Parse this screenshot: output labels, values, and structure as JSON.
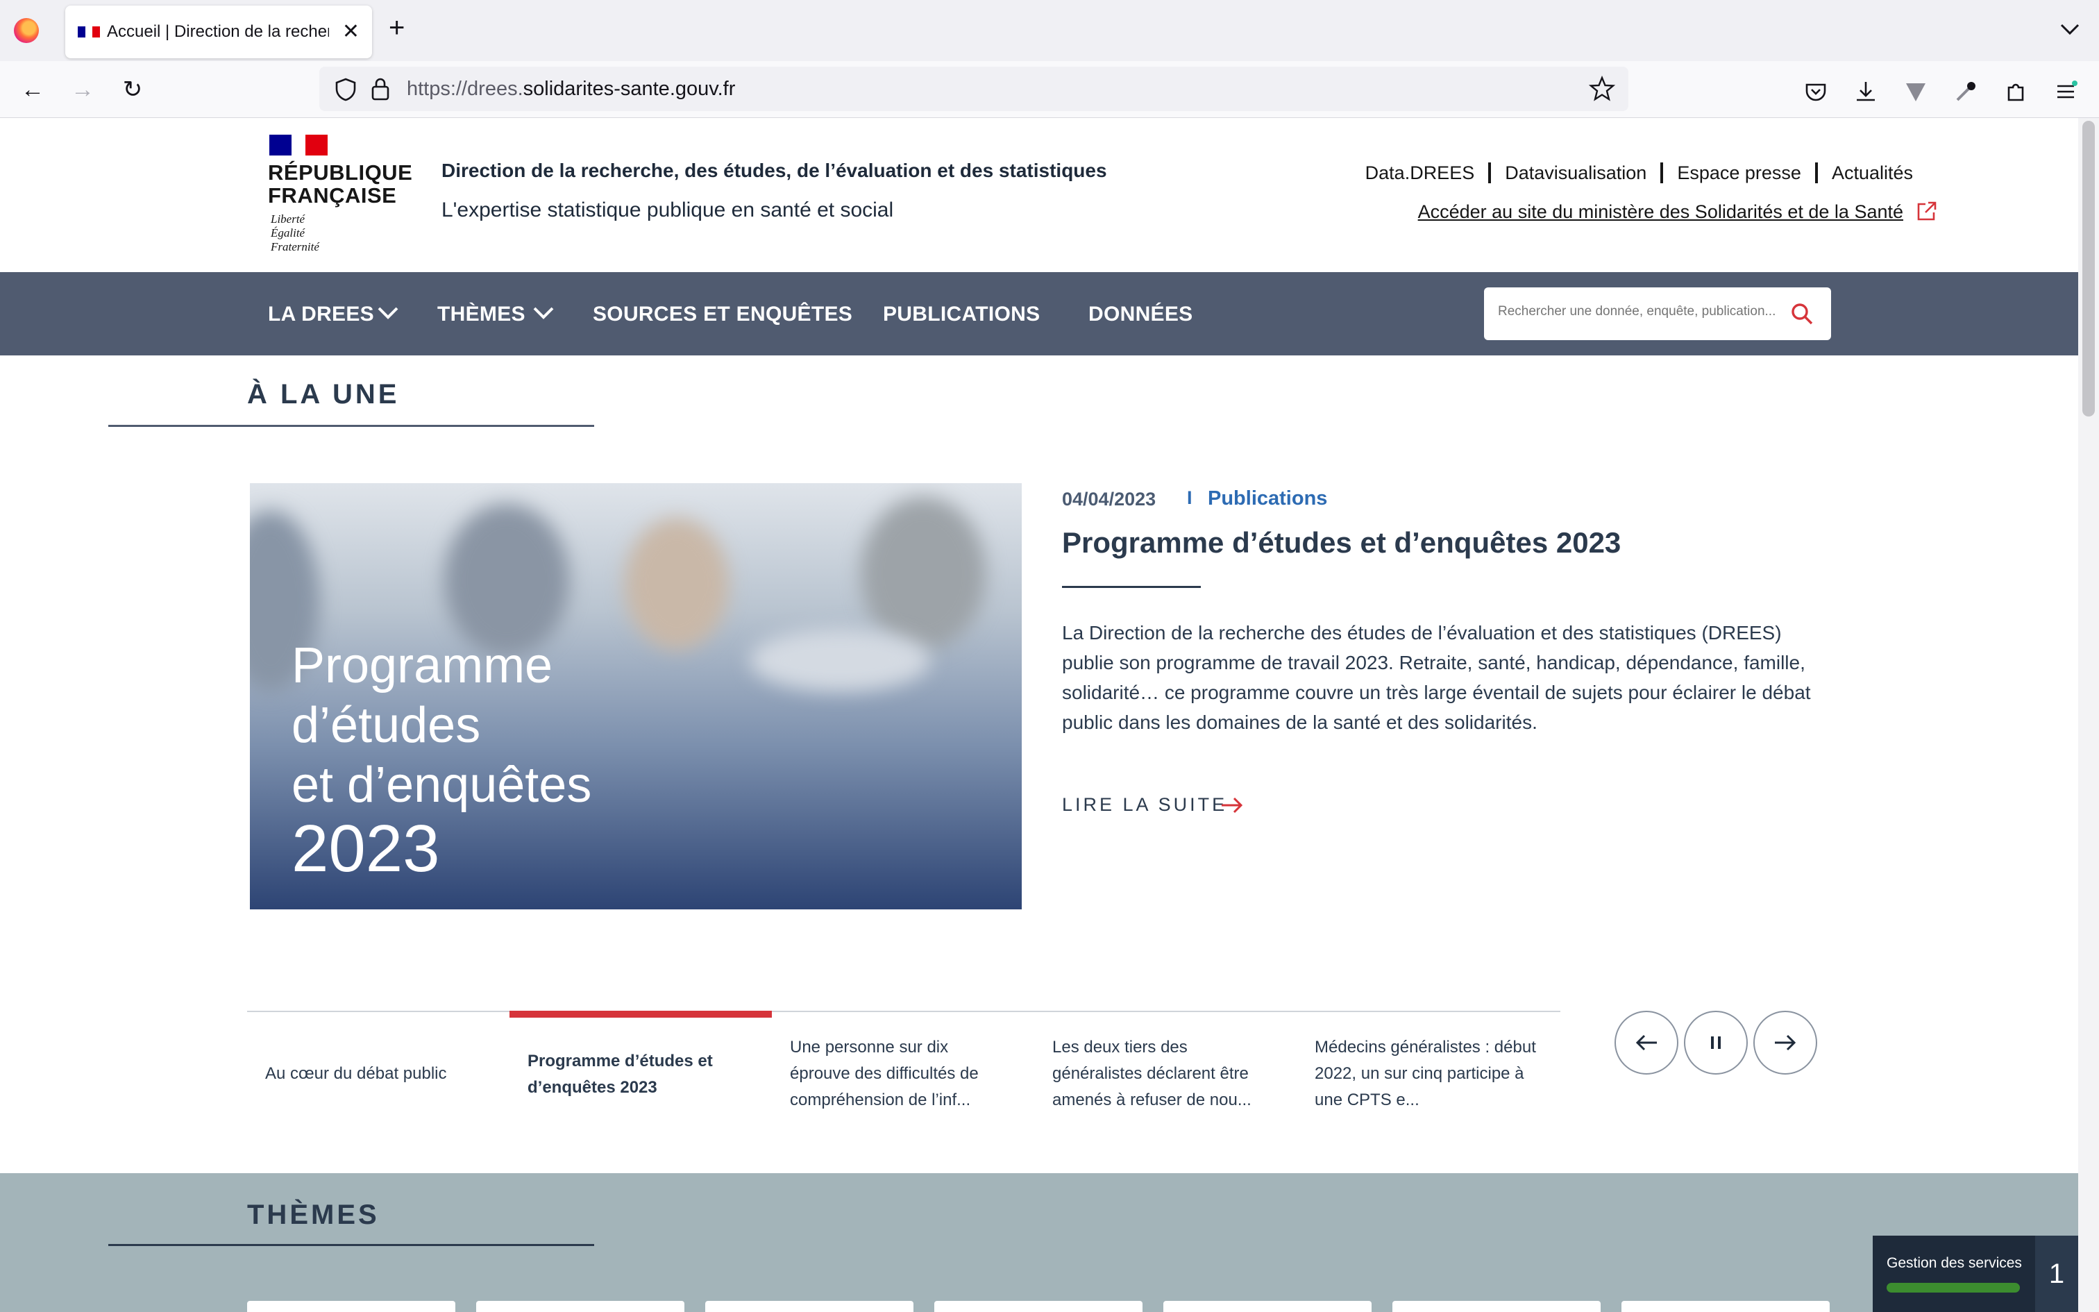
{
  "browser": {
    "tab_title": "Accueil | Direction de la recherche",
    "url_prefix": "https://drees.",
    "url_host": "solidarites-sante.gouv.fr"
  },
  "header": {
    "republique_line1": "RÉPUBLIQUE",
    "republique_line2": "FRANÇAISE",
    "motto_1": "Liberté",
    "motto_2": "Égalité",
    "motto_3": "Fraternité",
    "org_title": "Direction de la recherche, des études, de l’évaluation et des statistiques",
    "tagline": "L'expertise statistique publique en santé et social",
    "top_links": [
      "Data.DREES",
      "Datavisualisation",
      "Espace presse",
      "Actualités"
    ],
    "ministry_link": "Accéder au site du ministère des Solidarités et de la Santé"
  },
  "nav": {
    "items": [
      "LA DREES",
      "THÈMES",
      "SOURCES ET ENQUÊTES",
      "PUBLICATIONS",
      "DONNÉES"
    ],
    "search_placeholder": "Rechercher une donnée, enquête, publication..."
  },
  "a_la_une": {
    "section_title": "À LA UNE",
    "image_text_lines": [
      "Programme",
      "d’études",
      "et d’enquêtes"
    ],
    "image_year": "2023",
    "date": "04/04/2023",
    "separator": "I",
    "category": "Publications",
    "title": "Programme d’études et d’enquêtes 2023",
    "description": "La Direction de la recherche des études de l’évaluation et des statistiques (DREES) publie son programme de travail 2023. Retraite, santé, handicap, dépendance, famille, solidarité… ce programme couvre un très large éventail de sujets pour éclairer le débat public dans les domaines de la santé et des solidarités.",
    "read_more": "LIRE LA SUITE"
  },
  "carousel": {
    "tabs": [
      {
        "line1": "Au cœur du débat public",
        "line2": "",
        "line3": ""
      },
      {
        "line1": "Programme d’études et",
        "line2": "d’enquêtes 2023",
        "line3": ""
      },
      {
        "line1": "Une personne sur dix",
        "line2": "éprouve des difficultés de",
        "line3": "compréhension de l’inf..."
      },
      {
        "line1": "Les deux tiers des",
        "line2": "généralistes déclarent être",
        "line3": "amenés à refuser de nou..."
      },
      {
        "line1": "Médecins généralistes : début",
        "line2": "2022, un sur cinq participe à",
        "line3": "une CPTS e..."
      }
    ],
    "active_index": 1
  },
  "themes": {
    "section_title": "THÈMES"
  },
  "cookie_widget": {
    "label": "Gestion des services",
    "count": "1"
  },
  "colors": {
    "nav_bg": "#505b70",
    "accent_red": "#d6343a",
    "link_blue": "#2d6bb3",
    "themes_bg": "#a3b4b9"
  }
}
